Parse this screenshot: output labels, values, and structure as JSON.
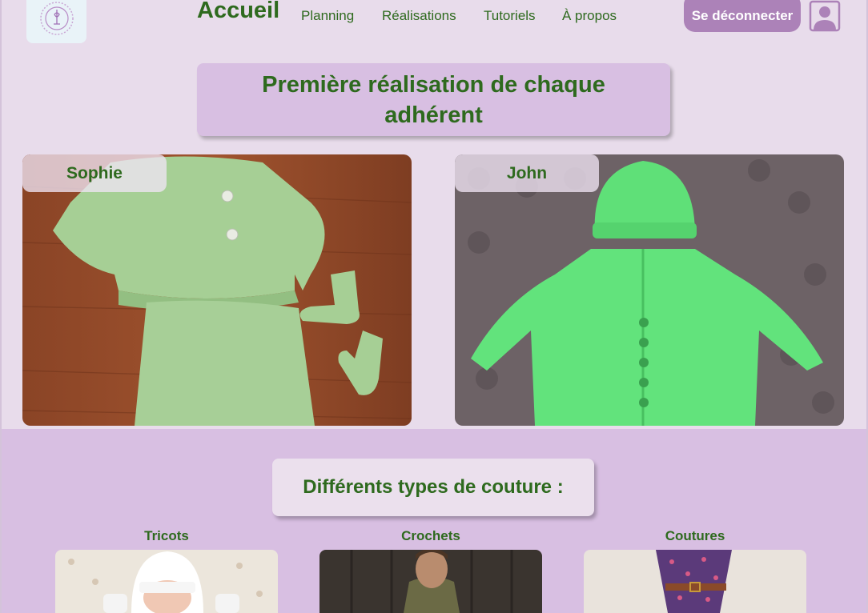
{
  "header": {
    "nav": {
      "home": "Accueil",
      "planning": "Planning",
      "realisations": "Réalisations",
      "tutorials": "Tutoriels",
      "about": "À propos"
    },
    "logout_label": "Se déconnecter"
  },
  "featured": {
    "title": "Première réalisation de chaque adhérent",
    "cards": [
      {
        "name": "Sophie"
      },
      {
        "name": "John"
      }
    ]
  },
  "types": {
    "title": "Différents types de couture :",
    "items": [
      {
        "label": "Tricots"
      },
      {
        "label": "Crochets"
      },
      {
        "label": "Coutures"
      }
    ]
  },
  "colors": {
    "background": "#e8dceb",
    "accent": "#d8bfe2",
    "text_green": "#2e6a1e",
    "button": "#ac82b8"
  }
}
